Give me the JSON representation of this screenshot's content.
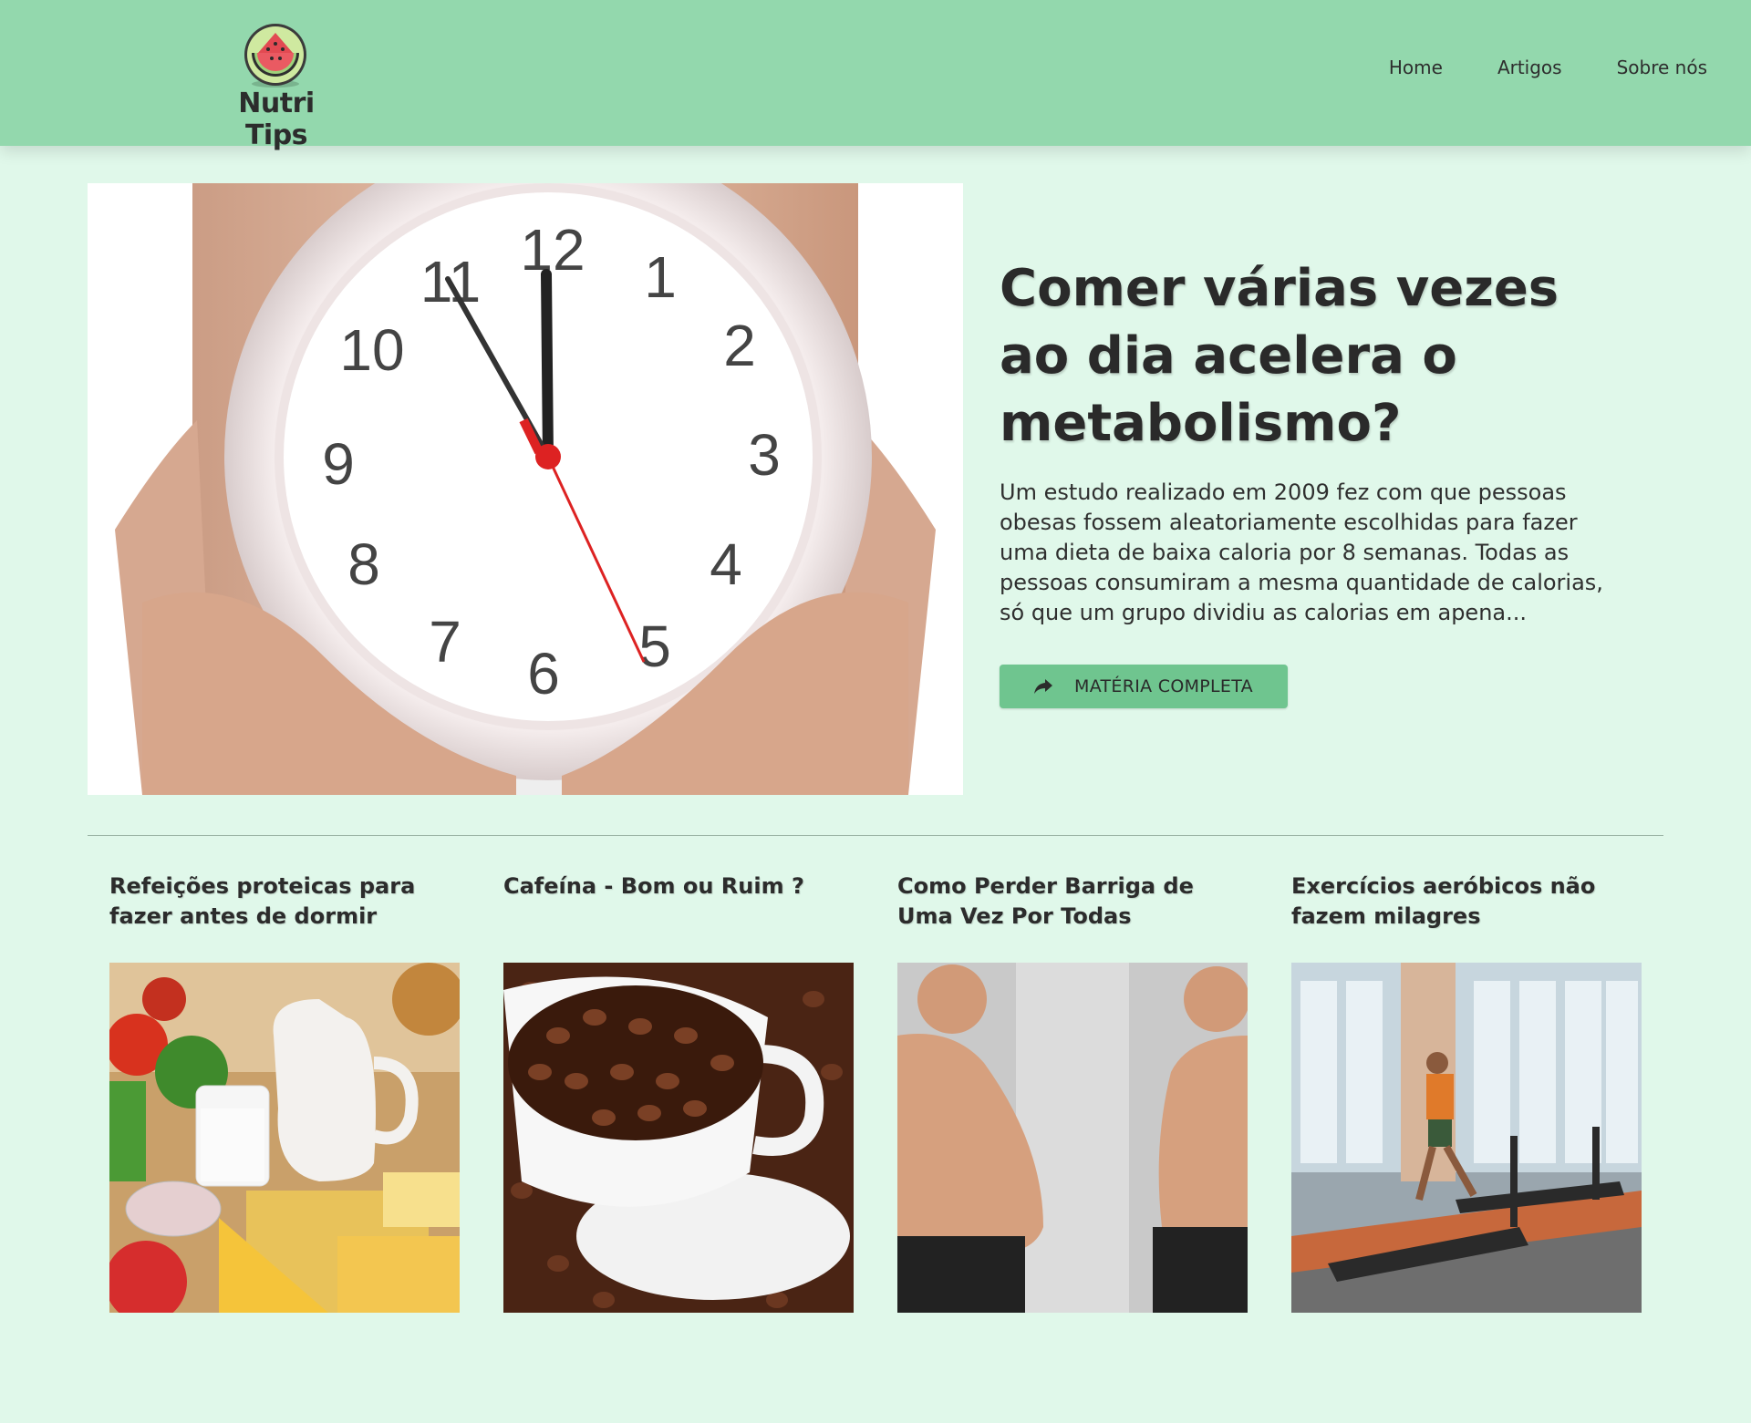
{
  "header": {
    "brand": "Nutri Tips",
    "logo_icon": "watermelon-icon",
    "nav": [
      {
        "label": "Home"
      },
      {
        "label": "Artigos"
      },
      {
        "label": "Sobre nós"
      }
    ]
  },
  "hero": {
    "title": "Comer várias vezes ao dia acelera o metabolismo?",
    "excerpt": "Um estudo realizado em 2009 fez com que pessoas obesas fossem aleatoriamente escolhidas para fazer uma dieta de baixa caloria por 8 semanas. Todas as pessoas consumiram a mesma quantidade de calorias, só que um grupo dividiu as calorias em apena...",
    "button_label": "MATÉRIA COMPLETA",
    "button_icon": "share-arrow-icon",
    "clock_numbers": [
      "12",
      "1",
      "2",
      "3",
      "4",
      "5",
      "6",
      "7",
      "8",
      "9",
      "10",
      "11"
    ]
  },
  "articles": [
    {
      "title": "Refeições proteicas para fazer antes de dormir"
    },
    {
      "title": "Cafeína - Bom ou Ruim ?"
    },
    {
      "title": "Como Perder Barriga de Uma Vez Por Todas"
    },
    {
      "title": "Exercícios aeróbicos não fazem milagres"
    }
  ],
  "colors": {
    "header_bg": "#93d8ad",
    "page_bg": "#e0f8ea",
    "button_bg": "#6fc58f"
  }
}
